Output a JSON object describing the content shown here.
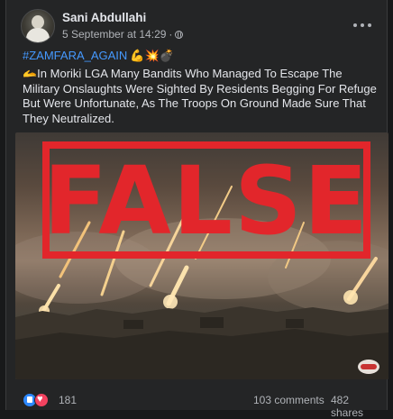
{
  "post": {
    "author": "Sani Abdullahi",
    "date": "5 September at 14:29",
    "separator": "·",
    "hashtag": "#ZAMFARA_AGAIN",
    "hashtag_emojis": "💪💥💣",
    "text": "🫴In Moriki LGA Many Bandits Who Managed To Escape The Military Onslaughts Were Sighted By Residents Begging For Refuge But Were Unfortunate, As The Troops On Ground Made Sure That They Neutralized."
  },
  "media": {
    "stamp_text": "FALSE",
    "stamp_color": "#e2262b"
  },
  "footer": {
    "reaction_count": "181",
    "comments": "103 comments",
    "shares": "482 shares"
  },
  "colors": {
    "background": "#18191a",
    "card": "#242526",
    "link": "#4599ff",
    "like": "#2d88ff",
    "love": "#f3425f"
  }
}
